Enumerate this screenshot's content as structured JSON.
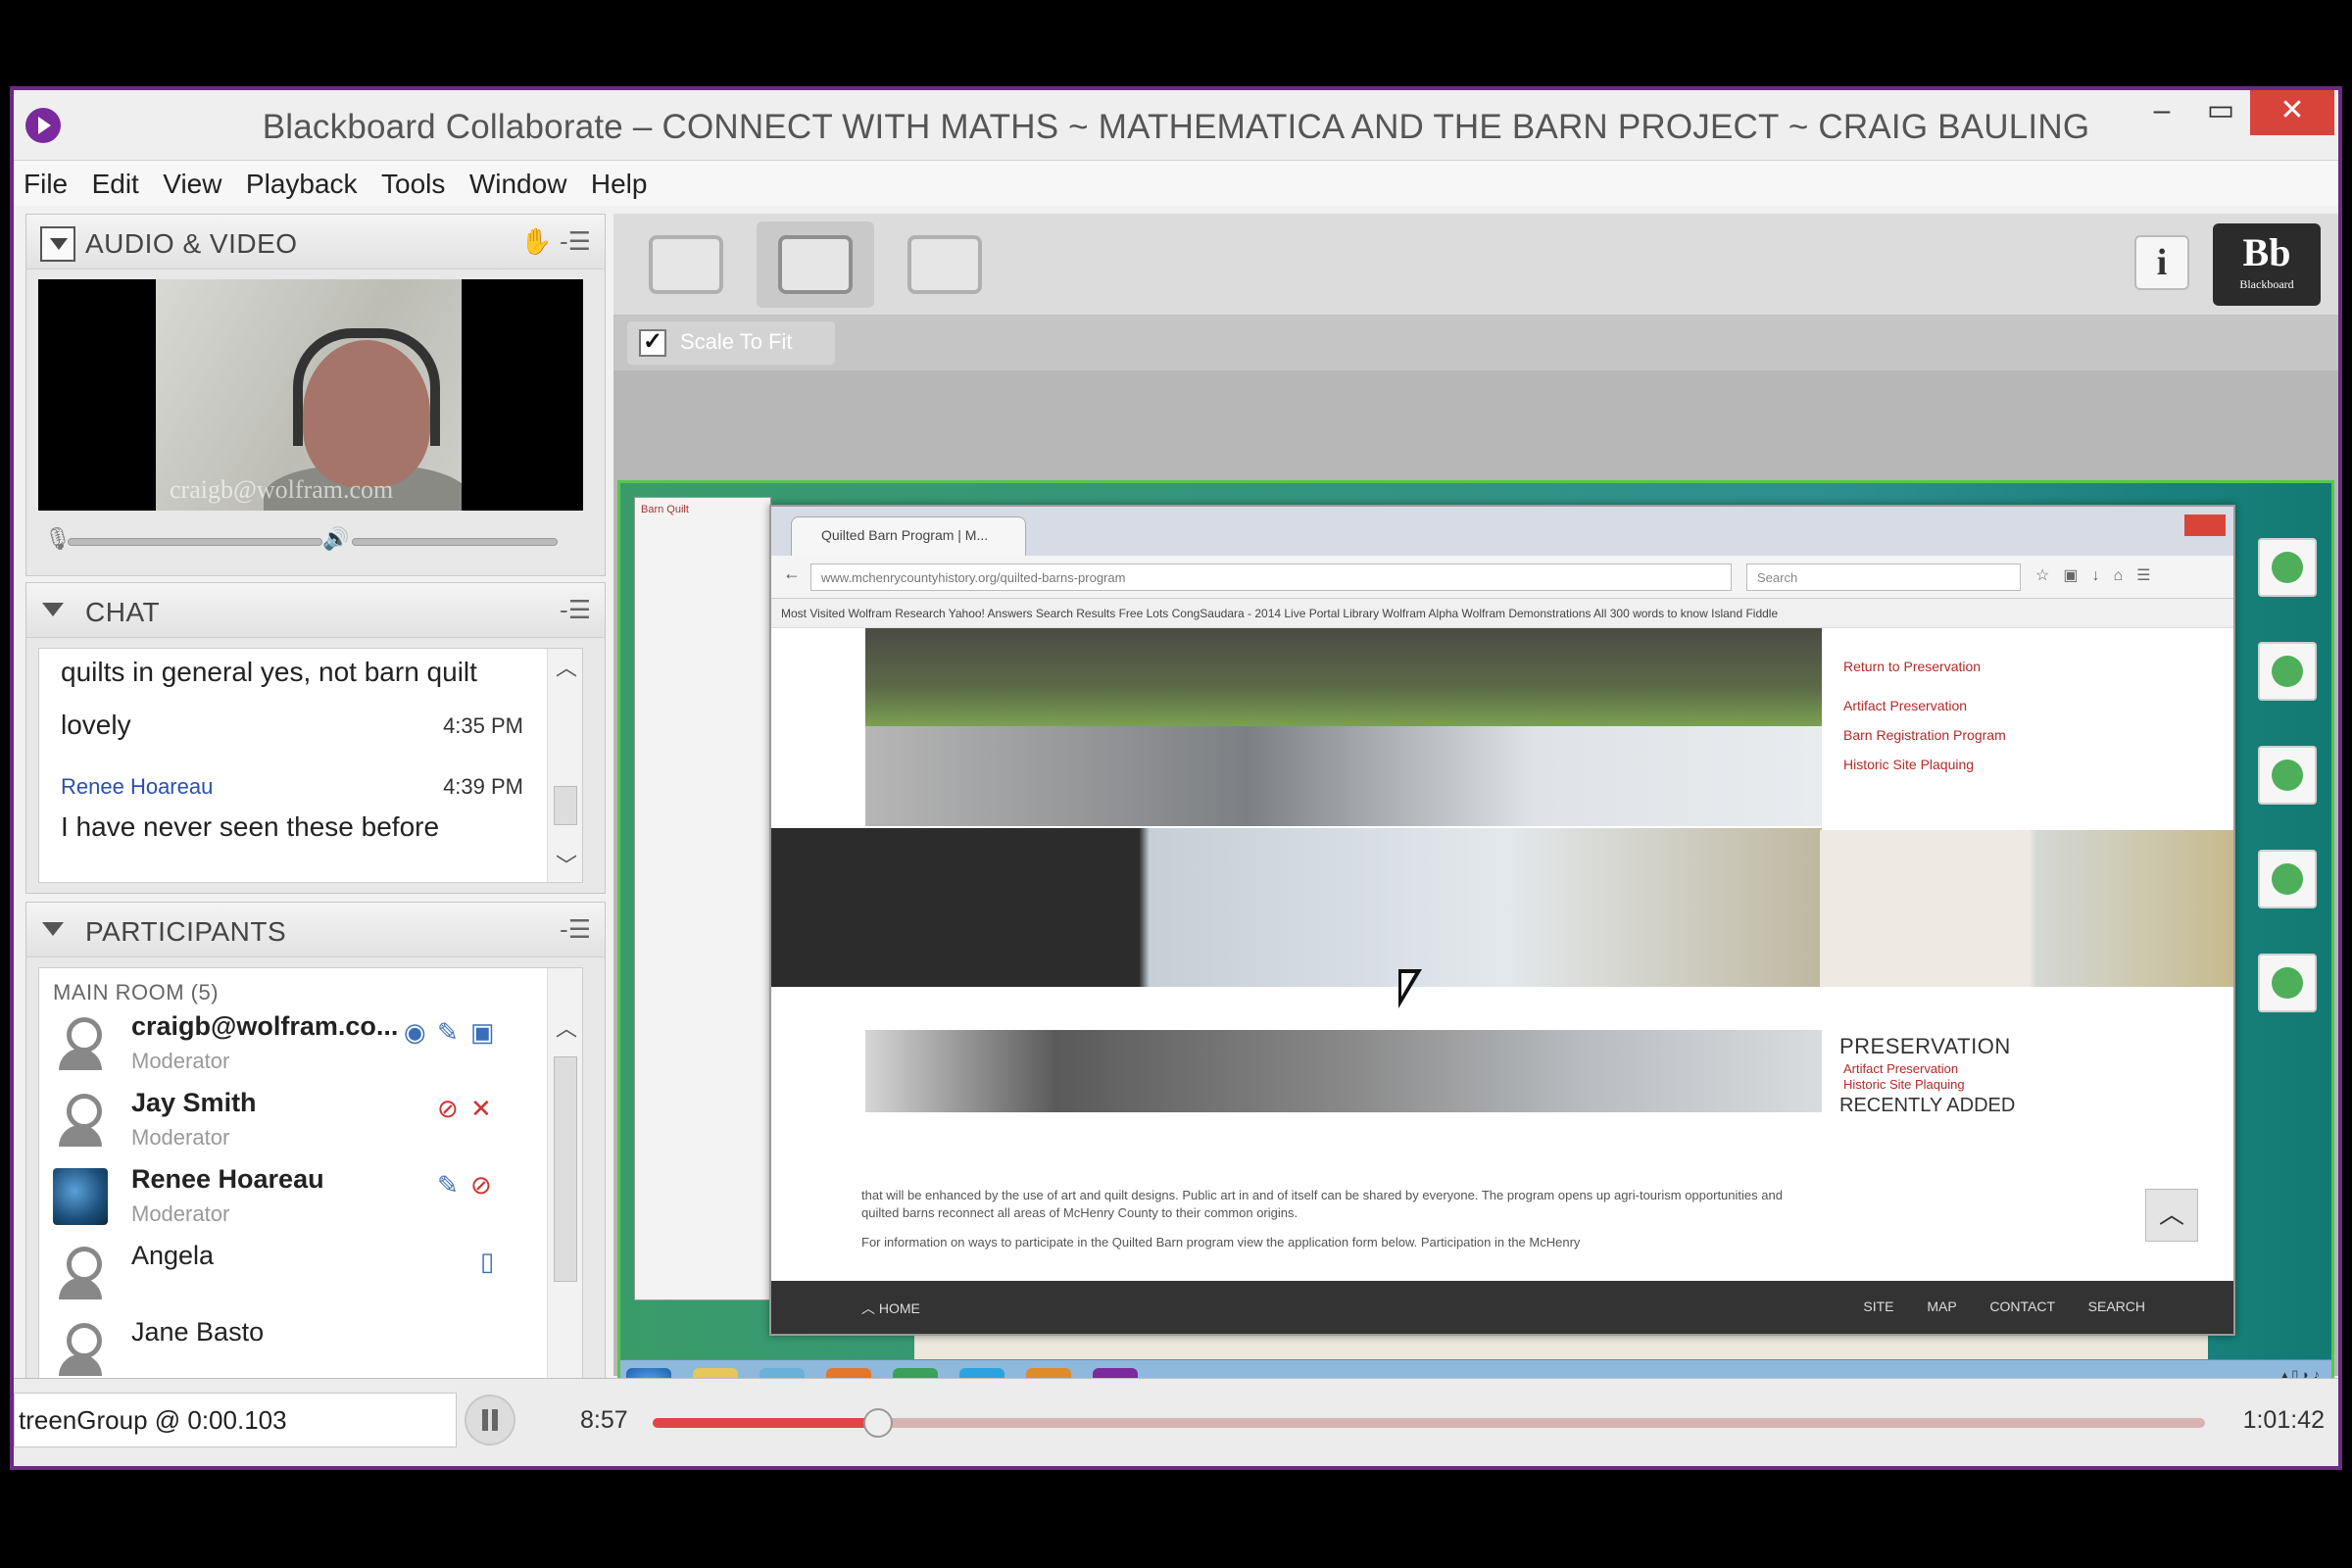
{
  "window": {
    "title": "Blackboard Collaborate – CONNECT WITH MATHS ~ MATHEMATICA AND THE BARN PROJECT ~ CRAIG BAULING",
    "minimize": "–",
    "maximize": "▭",
    "close": "✕"
  },
  "menu": [
    "File",
    "Edit",
    "View",
    "Playback",
    "Tools",
    "Window",
    "Help"
  ],
  "audio_video": {
    "title": "AUDIO & VIDEO",
    "video_watermark": "craigb@wolfram.com"
  },
  "chat": {
    "title": "CHAT",
    "messages": [
      {
        "text": "quilts in general yes, not barn quilt"
      },
      {
        "text": "lovely",
        "time": "4:35 PM"
      },
      {
        "sender": "Renee Hoareau",
        "time": "4:39 PM",
        "text": "I have never seen these before"
      }
    ]
  },
  "participants": {
    "title": "PARTICIPANTS",
    "room": "MAIN ROOM (5)",
    "list": [
      {
        "name": "craigb@wolfram.co...",
        "role": "Moderator",
        "avatar": "person-icon"
      },
      {
        "name": "Jay Smith",
        "role": "Moderator",
        "avatar": "person-icon"
      },
      {
        "name": "Renee Hoareau",
        "role": "Moderator",
        "avatar": "globe-avatar"
      },
      {
        "name": "Angela",
        "role": "",
        "avatar": "person-icon"
      },
      {
        "name": "Jane Basto",
        "role": "",
        "avatar": "person-icon"
      }
    ]
  },
  "toolbar": {
    "info": "i",
    "logo": "Bb",
    "logo_sub": "Blackboard",
    "scale_to_fit": "Scale To Fit",
    "scale_checked": true
  },
  "shared_browser": {
    "tab": "Quilted Barn Program | M...",
    "back_tab": "Barn Quilt",
    "url": "www.mchenrycountyhistory.org/quilted-barns-program",
    "search_placeholder": "Search",
    "bookmarks": "Most Visited   Wolfram Research   Yahoo! Answers   Search Results   Free Lots   CongSaudara - 2014   Live Portal   Library   Wolfram Alpha   Wolfram Demonstrations   All 300 words to know   Island Fiddle",
    "side_list": [
      "Return to Preservation",
      "Artifact Preservation",
      "Barn Registration Program",
      "Historic Site Plaquing"
    ],
    "preservation_heading": "PRESERVATION",
    "preservation_items": [
      "Artifact Preservation",
      "Historic Site Plaquing"
    ],
    "recently_added": "RECENTLY ADDED",
    "paragraph_1": "that will be enhanced by the use of art and quilt designs. Public art in and of itself can be shared by everyone. The program opens up agri-tourism opportunities and quilted barns reconnect all areas of McHenry County to their common origins.",
    "paragraph_2": "For information on ways to participate in the Quilted Barn program view the application form below. Participation in the McHenry",
    "footer_home": "HOME",
    "footer_links": [
      "SITE MAP",
      "CONTACT",
      "SEARCH"
    ]
  },
  "playback": {
    "status": "treenGroup @ 0:00.103",
    "current_time": "8:57",
    "total_time": "1:01:42",
    "progress": 0.145
  },
  "colors": {
    "frame": "#6b2a85",
    "accent_red": "#e04646",
    "link_blue": "#2a4fb0"
  }
}
